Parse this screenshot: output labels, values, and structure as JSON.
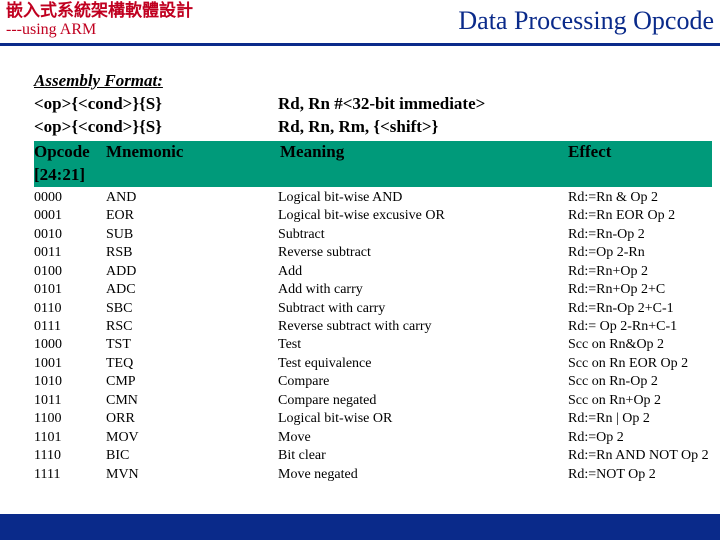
{
  "header": {
    "zh": "嵌入式系統架構軟體設計",
    "en": "---using ARM",
    "title": "Data Processing Opcode"
  },
  "format": {
    "label": "Assembly Format:",
    "line1_left": "<op>{<cond>}{S}",
    "line1_right": "Rd, Rn #<32-bit immediate>",
    "line2_left": "<op>{<cond>}{S}",
    "line2_right": "Rd, Rn, Rm, {<shift>}"
  },
  "table": {
    "headers": {
      "opcode": "Opcode [24:21]",
      "mnemonic": "Mnemonic",
      "meaning": "Meaning",
      "effect": "Effect"
    },
    "rows": [
      {
        "opcode": "0000",
        "mnemonic": "AND",
        "meaning": "Logical bit-wise AND",
        "effect": "Rd:=Rn & Op 2"
      },
      {
        "opcode": "0001",
        "mnemonic": "EOR",
        "meaning": "Logical bit-wise excusive OR",
        "effect": "Rd:=Rn EOR Op 2"
      },
      {
        "opcode": "0010",
        "mnemonic": "SUB",
        "meaning": "Subtract",
        "effect": "Rd:=Rn-Op 2"
      },
      {
        "opcode": "0011",
        "mnemonic": "RSB",
        "meaning": "Reverse subtract",
        "effect": "Rd:=Op 2-Rn"
      },
      {
        "opcode": "0100",
        "mnemonic": "ADD",
        "meaning": "Add",
        "effect": "Rd:=Rn+Op 2"
      },
      {
        "opcode": "0101",
        "mnemonic": "ADC",
        "meaning": "Add with carry",
        "effect": "Rd:=Rn+Op 2+C"
      },
      {
        "opcode": "0110",
        "mnemonic": "SBC",
        "meaning": "Subtract with carry",
        "effect": "Rd:=Rn-Op 2+C-1"
      },
      {
        "opcode": "0111",
        "mnemonic": "RSC",
        "meaning": "Reverse subtract with carry",
        "effect": "Rd:= Op 2-Rn+C-1"
      },
      {
        "opcode": "1000",
        "mnemonic": "TST",
        "meaning": "Test",
        "effect": "Scc on Rn&Op 2"
      },
      {
        "opcode": "1001",
        "mnemonic": "TEQ",
        "meaning": "Test equivalence",
        "effect": "Scc on Rn EOR Op 2"
      },
      {
        "opcode": "1010",
        "mnemonic": "CMP",
        "meaning": "Compare",
        "effect": "Scc on Rn-Op 2"
      },
      {
        "opcode": "1011",
        "mnemonic": "CMN",
        "meaning": "Compare negated",
        "effect": "Scc on Rn+Op 2"
      },
      {
        "opcode": "1100",
        "mnemonic": "ORR",
        "meaning": "Logical bit-wise OR",
        "effect": "Rd:=Rn | Op 2"
      },
      {
        "opcode": "1101",
        "mnemonic": "MOV",
        "meaning": "Move",
        "effect": "Rd:=Op 2"
      },
      {
        "opcode": "1110",
        "mnemonic": "BIC",
        "meaning": "Bit clear",
        "effect": "Rd:=Rn AND NOT Op 2"
      },
      {
        "opcode": "1111",
        "mnemonic": "MVN",
        "meaning": "Move negated",
        "effect": "Rd:=NOT Op 2"
      }
    ]
  }
}
